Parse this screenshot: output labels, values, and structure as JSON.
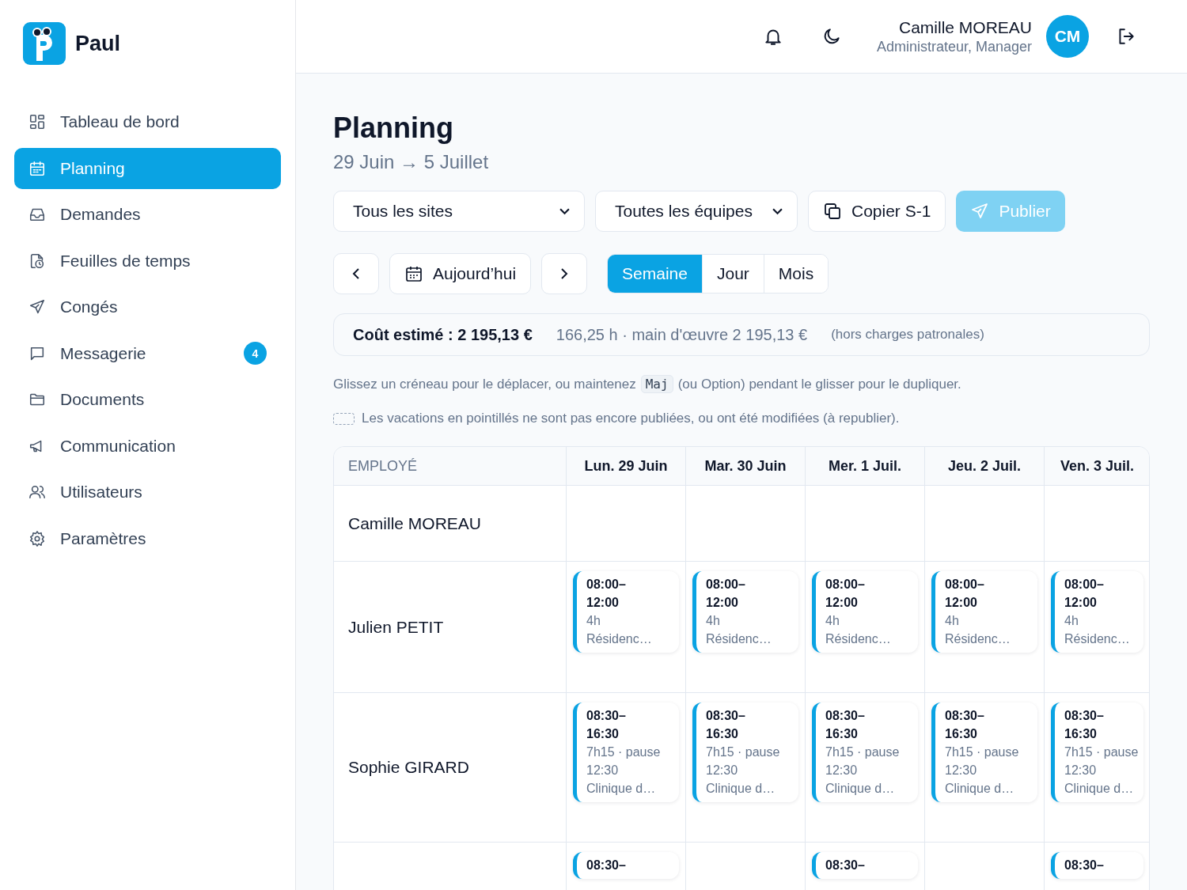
{
  "app": {
    "name": "Paul"
  },
  "sidebar": {
    "items": [
      {
        "label": "Tableau de bord",
        "selected": false
      },
      {
        "label": "Planning",
        "selected": true
      },
      {
        "label": "Demandes",
        "selected": false
      },
      {
        "label": "Feuilles de temps",
        "selected": false
      },
      {
        "label": "Congés",
        "selected": false
      },
      {
        "label": "Messagerie",
        "selected": false,
        "badge": "4"
      },
      {
        "label": "Documents",
        "selected": false
      },
      {
        "label": "Communication",
        "selected": false
      },
      {
        "label": "Utilisateurs",
        "selected": false
      },
      {
        "label": "Paramètres",
        "selected": false
      }
    ]
  },
  "user": {
    "name": "Camille MOREAU",
    "role": "Administrateur, Manager",
    "initials": "CM"
  },
  "page": {
    "title": "Planning",
    "subtitle": "29 Juin → 5 Juillet"
  },
  "filters": {
    "site": "Tous les sites",
    "team": "Toutes les équipes",
    "copy": "Copier S-1",
    "publish": {
      "label": "Publier",
      "disabled": true
    }
  },
  "navigation": {
    "today": "Aujourd’hui",
    "views": [
      {
        "label": "Semaine",
        "selected": true
      },
      {
        "label": "Jour",
        "selected": false
      },
      {
        "label": "Mois",
        "selected": false
      }
    ]
  },
  "cost": {
    "total": "Coût estimé : 2 195,13 €",
    "detail": "166,25 h · main d'œuvre 2 195,13 €",
    "note": "(hors charges patronales)"
  },
  "hint": {
    "before": "Glissez un créneau pour le déplacer, ou maintenez",
    "key": "Maj",
    "after": "(ou Option) pendant le glisser pour le dupliquer."
  },
  "legend": "Les vacations en pointillés ne sont pas encore publiées, ou ont été modifiées (à republier).",
  "table": {
    "employee_column": "EMPLOYÉ",
    "days": [
      "Lun. 29 Juin",
      "Mar. 30 Juin",
      "Mer. 1 Juil.",
      "Jeu. 2 Juil.",
      "Ven. 3 Juil."
    ],
    "rows": [
      {
        "employee": "Camille MOREAU",
        "shifts": [
          {
            "kind": "empty"
          },
          {
            "kind": "empty"
          },
          {
            "kind": "empty"
          },
          {
            "kind": "empty"
          },
          {
            "kind": "empty"
          }
        ]
      },
      {
        "employee": "Julien PETIT",
        "shifts": [
          {
            "kind": "shift",
            "time": "08:00–12:00",
            "duration": "4h",
            "site": "Résidenc…",
            "published": true
          },
          {
            "kind": "shift",
            "time": "08:00–12:00",
            "duration": "4h",
            "site": "Résidenc…",
            "published": true
          },
          {
            "kind": "shift",
            "time": "08:00–12:00",
            "duration": "4h",
            "site": "Résidenc…",
            "published": true
          },
          {
            "kind": "shift",
            "time": "08:00–12:00",
            "duration": "4h",
            "site": "Résidenc…",
            "published": true
          },
          {
            "kind": "shift",
            "time": "08:00–12:00",
            "duration": "4h",
            "site": "Résidenc…",
            "published": true
          }
        ]
      },
      {
        "employee": "Sophie GIRARD",
        "shifts": [
          {
            "kind": "shift",
            "time": "08:30–16:30",
            "duration": "7h15 · pause 12:30",
            "site": "Clinique d…",
            "published": true
          },
          {
            "kind": "shift",
            "time": "08:30–16:30",
            "duration": "7h15 · pause 12:30",
            "site": "Clinique d…",
            "published": true
          },
          {
            "kind": "shift",
            "time": "08:30–16:30",
            "duration": "7h15 · pause 12:30",
            "site": "Clinique d…",
            "published": true
          },
          {
            "kind": "shift",
            "time": "08:30–16:30",
            "duration": "7h15 · pause 12:30",
            "site": "Clinique d…",
            "published": true
          },
          {
            "kind": "shift",
            "time": "08:30–16:30",
            "duration": "7h15 · pause 12:30",
            "site": "Clinique d…",
            "published": true
          }
        ]
      },
      {
        "shifts": [
          {
            "kind": "shift",
            "time": "08:30–",
            "published": true
          },
          {
            "kind": "empty"
          },
          {
            "kind": "shift",
            "time": "08:30–",
            "published": true
          },
          {
            "kind": "empty"
          },
          {
            "kind": "shift",
            "time": "08:30–",
            "published": true
          }
        ]
      }
    ]
  }
}
